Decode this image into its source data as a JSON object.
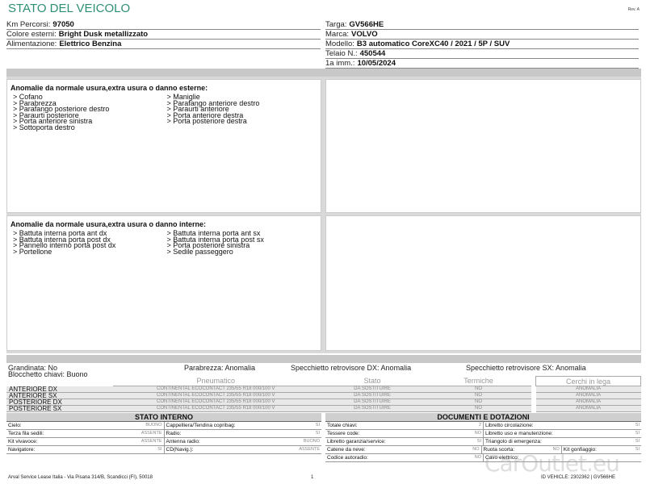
{
  "header": {
    "title": "STATO DEL VEICOLO",
    "rev": "Rev. A"
  },
  "vehicle_left": [
    {
      "label": "Km Percorsi:",
      "value": "97050"
    },
    {
      "label": "Colore esterni:",
      "value": "Bright Dusk metallizzato"
    },
    {
      "label": "Alimentazione:",
      "value": "Elettrico Benzina"
    }
  ],
  "vehicle_right": [
    {
      "label": "Targa:",
      "value": "GV566HE"
    },
    {
      "label": "Marca:",
      "value": "VOLVO"
    },
    {
      "label": "Modello:",
      "value": "B3 automatico CoreXC40 / 2021 / 5P / SUV"
    },
    {
      "label": "Telaio N.:",
      "value": "450544"
    },
    {
      "label": "1a imm.:",
      "value": "10/05/2024"
    }
  ],
  "damage_external": {
    "title": "Anomalie da normale usura,extra usura o danno esterne:",
    "col1": [
      "> Cofano",
      "> Parabrezza",
      "> Parafango posteriore destro",
      "> Paraurti posteriore",
      "> Porta anteriore sinistra",
      "> Sottoporta destro"
    ],
    "col2": [
      "> Maniglie",
      "> Parafango anteriore destro",
      "> Paraurti anteriore",
      "> Porta anteriore destra",
      "> Porta posteriore destra"
    ]
  },
  "damage_internal": {
    "title": "Anomalie da normale usura,extra usura o danno interne:",
    "col1": [
      "> Battuta interna porta ant dx",
      "> Battuta interna porta post dx",
      "> Pannello interno porta post dx",
      "> Portellone"
    ],
    "col2": [
      "> Battuta interna porta ant sx",
      "> Battuta interna porta post sx",
      "> Porta posteriore sinistra",
      "> Sedile passeggero"
    ]
  },
  "status": {
    "grandinata": "Grandinata: No",
    "parabrezza": "Parabrezza: Anomalia",
    "specchietto_dx": "Specchietto retrovisore DX: Anomalia",
    "specchietto_sx": "Specchietto retrovisore SX: Anomalia",
    "blocchetto": "Blocchetto chiavi: Buono"
  },
  "tyres": {
    "headers": {
      "pneumatico": "Pneumatico",
      "stato": "Stato",
      "termiche": "Termiche",
      "cerchi": "Cerchi in lega"
    },
    "rows": [
      {
        "pos": "ANTERIORE DX",
        "tyre": "CONTINENTAL ECOCONTACT  235/55 R18 000/100 V",
        "stato": "DA SOSTITUIRE",
        "termiche": "NO",
        "cerchi": "ANOMALIA"
      },
      {
        "pos": "ANTERIORE SX",
        "tyre": "CONTINENTAL ECOCONTACT  235/55 R18 000/100 V",
        "stato": "DA SOSTITUIRE",
        "termiche": "NO",
        "cerchi": "ANOMALIA"
      },
      {
        "pos": "POSTERIORE DX",
        "tyre": "CONTINENTAL ECOCONTACT  235/55 R18 000/100 V",
        "stato": "DA SOSTITUIRE",
        "termiche": "NO",
        "cerchi": "ANOMALIA"
      },
      {
        "pos": "POSTERIORE SX",
        "tyre": "CONTINENTAL ECOCONTACT  235/55 R18 000/100 V",
        "stato": "DA SOSTITUIRE",
        "termiche": "NO",
        "cerchi": "ANOMALIA"
      }
    ]
  },
  "stato_interno": {
    "title": "STATO INTERNO",
    "rows": [
      [
        {
          "l": "Cielo:",
          "v": "BUONO"
        },
        {
          "l": "Cappelliera/Tendina copribag:",
          "v": "SI"
        }
      ],
      [
        {
          "l": "Terza fila sedili:",
          "v": "ASSENTE"
        },
        {
          "l": "Radio:",
          "v": "SI"
        }
      ],
      [
        {
          "l": "Kit vivavoce:",
          "v": "ASSENTE"
        },
        {
          "l": "Antenna radio:",
          "v": "BUONO"
        }
      ],
      [
        {
          "l": "Navigatore:",
          "v": "SI"
        },
        {
          "l": "CD(Navig.):",
          "v": "ASSENTE"
        }
      ]
    ]
  },
  "documenti": {
    "title": "DOCUMENTI E DOTAZIONI",
    "rows": [
      [
        {
          "l": "Totale chiavi:",
          "v": "2"
        },
        {
          "l": "Libretto circolazione:",
          "v": "SI"
        }
      ],
      [
        {
          "l": "Tessere code:",
          "v": "NO"
        },
        {
          "l": "Libretto uso e manutenzione:",
          "v": "SI"
        }
      ],
      [
        {
          "l": "Libretto garanzia/service:",
          "v": "SI"
        },
        {
          "l": "Triangolo di emergenza:",
          "v": "SI"
        }
      ],
      [
        {
          "l": "Catene da neve:",
          "v": "NO"
        },
        {
          "l": "Ruota scorta:",
          "v": "NO"
        },
        {
          "l": "Kit gonfiaggio:",
          "v": "SI"
        }
      ],
      [
        {
          "l": "Codice autoradio:",
          "v": "NO"
        },
        {
          "l": "Cavo elettrico:",
          "v": ""
        }
      ]
    ]
  },
  "footer": {
    "company": "Arval Service Lease Italia - Via Pisana 314/B, Scandicci (FI), 50018",
    "page": "1",
    "code": "ID VEHICLE: 2302362 | GV566HE"
  },
  "watermark": "CarOutlet.eu"
}
